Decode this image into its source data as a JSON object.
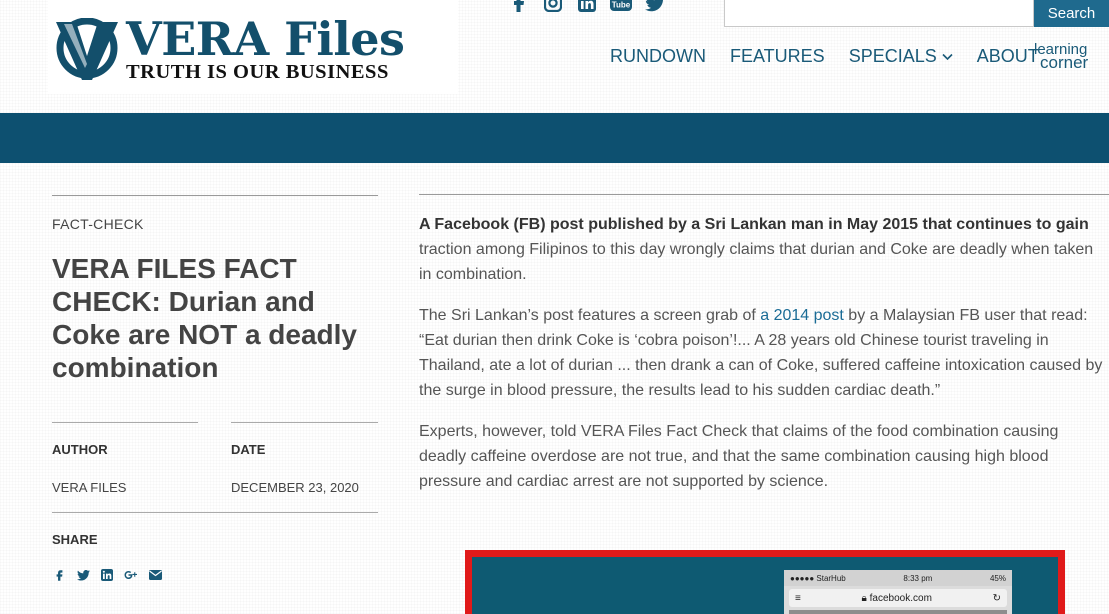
{
  "site": {
    "logo_letter": "V",
    "logo_title": "VERA Files",
    "logo_tagline": "TRUTH IS OUR BUSINESS"
  },
  "header": {
    "social_icons": [
      "facebook-icon",
      "instagram-icon",
      "linkedin-icon",
      "youtube-icon",
      "twitter-icon"
    ],
    "youtube_text": "Tube",
    "search_placeholder": "",
    "search_button": "Search",
    "nav": [
      {
        "label": "RUNDOWN"
      },
      {
        "label": "FEATURES"
      },
      {
        "label": "SPECIALS",
        "dropdown": true
      },
      {
        "label": "ABOUT"
      }
    ],
    "learning_corner": {
      "line1": "learning",
      "line2": "corner"
    }
  },
  "colors": {
    "brand": "#134f6b",
    "banner": "#0d5070",
    "accent_link": "#1a6b95",
    "search_button": "#1f6a8e",
    "embed_border": "#e01a1a"
  },
  "article": {
    "category": "FACT-CHECK",
    "headline": "VERA FILES FACT CHECK: Durian and Coke are NOT a deadly combination",
    "author_label": "AUTHOR",
    "author": "VERA FILES",
    "date_label": "DATE",
    "date": "DECEMBER 23, 2020",
    "share_label": "SHARE",
    "share_icons": [
      "facebook-icon",
      "twitter-icon",
      "linkedin-icon",
      "google-plus-icon",
      "email-icon"
    ],
    "p1_bold": "A Facebook (FB) post published by a Sri Lankan man in May 2015 that continues to gain",
    "p1_rest": "traction among Filipinos to this day wrongly claims that durian and Coke are deadly when taken in combination.",
    "p2_before": "The Sri Lankan’s post features a screen grab of ",
    "p2_link": "a 2014 post",
    "p2_after": " by a Malaysian FB user that read: “Eat durian then drink Coke is ‘cobra poison’!... A 28 years old Chinese tourist traveling in Thailand, ate a lot of durian ... then drank a can of Coke, suffered caffeine intoxication caused by the surge in blood pressure, the results lead to his sudden cardiac death.”",
    "p3": "Experts, however, told VERA Files Fact Check that claims of the food combination causing deadly caffeine overdose are not true, and that the same combination causing high blood pressure and cardiac arrest are not supported by science."
  },
  "embed_phone": {
    "carrier": "●●●●● StarHub",
    "time": "8:33 pm",
    "battery": "45%",
    "url": "facebook.com"
  }
}
